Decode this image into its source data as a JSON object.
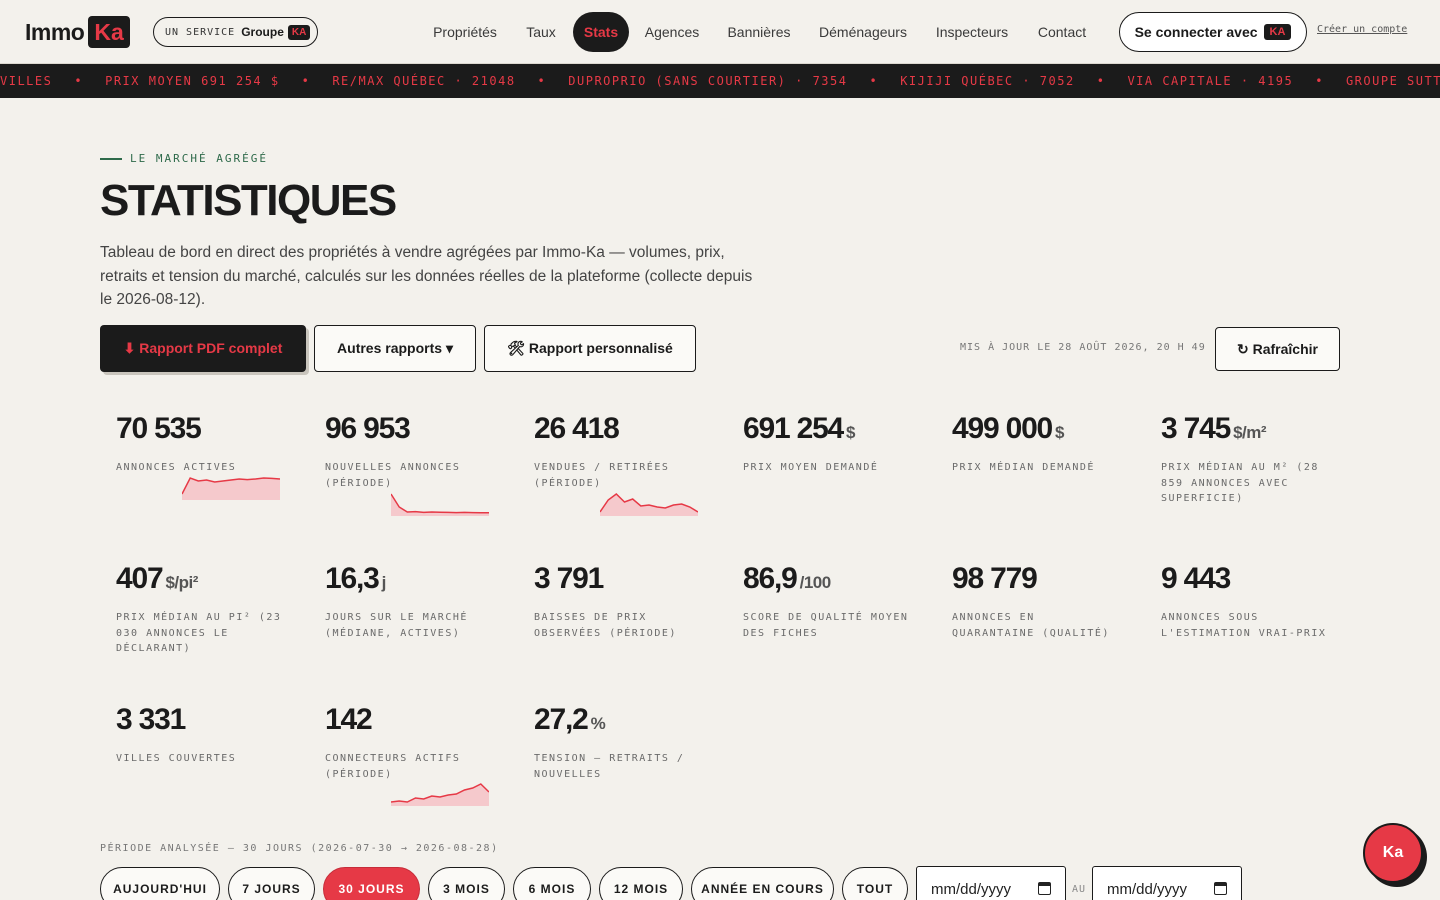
{
  "header": {
    "logo": {
      "immo": "Immo",
      "ka": "Ka"
    },
    "service": {
      "un": "UN SERVICE",
      "groupe": "Groupe",
      "badge": "KA"
    },
    "nav": [
      "Propriétés",
      "Taux",
      "Stats",
      "Agences",
      "Bannières",
      "Déménageurs",
      "Inspecteurs",
      "Contact"
    ],
    "active_nav": "Stats",
    "connect_label": "Se connecter avec",
    "connect_badge": "KA",
    "create_account": "Créer un compte"
  },
  "ticker": [
    "VILLES",
    "PRIX MOYEN 691 254 $",
    "RE/MAX QUÉBEC · 21048",
    "DUPROPRIO (SANS COURTIER) · 7354",
    "KIJIJI QUÉBEC · 7052",
    "VIA CAPITALE · 4195",
    "GROUPE SUTTON QUÉBEC ·"
  ],
  "hero": {
    "eyebrow": "LE MARCHÉ AGRÉGÉ",
    "title": "STATISTIQUES",
    "description": "Tableau de bord en direct des propriétés à vendre agrégées par Immo-Ka — volumes, prix, retraits et tension du marché, calculés sur les données réelles de la plateforme (collecte depuis le 2026-08-12)."
  },
  "actions": {
    "pdf": "⬇ Rapport PDF complet",
    "other": "Autres rapports ▾",
    "custom": "🛠 Rapport personnalisé",
    "updated": "MIS À JOUR LE 28 AOÛT 2026, 20 H 49",
    "refresh": "↻ Rafraîchir"
  },
  "stats": [
    {
      "value": "70 535",
      "unit": "",
      "label": "ANNONCES ACTIVES"
    },
    {
      "value": "96 953",
      "unit": "",
      "label": "NOUVELLES ANNONCES (PÉRIODE)"
    },
    {
      "value": "26 418",
      "unit": "",
      "label": "VENDUES / RETIRÉES (PÉRIODE)"
    },
    {
      "value": "691 254",
      "unit": "$",
      "label": "PRIX MOYEN DEMANDÉ"
    },
    {
      "value": "499 000",
      "unit": "$",
      "label": "PRIX MÉDIAN DEMANDÉ"
    },
    {
      "value": "3 745",
      "unit": "$/m²",
      "label": "PRIX MÉDIAN AU M² (28 859 ANNONCES AVEC SUPERFICIE)"
    },
    {
      "value": "407",
      "unit": "$/pi²",
      "label": "PRIX MÉDIAN AU PI² (23 030 ANNONCES LE DÉCLARANT)"
    },
    {
      "value": "16,3",
      "unit": "j",
      "label": "JOURS SUR LE MARCHÉ (MÉDIANE, ACTIVES)"
    },
    {
      "value": "3 791",
      "unit": "",
      "label": "BAISSES DE PRIX OBSERVÉES (PÉRIODE)"
    },
    {
      "value": "86,9",
      "unit": "/100",
      "label": "SCORE DE QUALITÉ MOYEN DES FICHES"
    },
    {
      "value": "98 779",
      "unit": "",
      "label": "ANNONCES EN QUARANTAINE (QUALITÉ)"
    },
    {
      "value": "9 443",
      "unit": "",
      "label": "ANNONCES SOUS L'ESTIMATION VRAI-PRIX"
    },
    {
      "value": "3 331",
      "unit": "",
      "label": "VILLES COUVERTES"
    },
    {
      "value": "142",
      "unit": "",
      "label": "CONNECTEURS ACTIFS (PÉRIODE)"
    },
    {
      "value": "27,2",
      "unit": "%",
      "label": "TENSION — RETRAITS / NOUVELLES"
    }
  ],
  "sparklines": {
    "accent": "#e63946",
    "fill": "#f5c9cc",
    "annonces_actives": [
      0.2,
      1.0,
      0.85,
      0.9,
      0.8,
      0.85,
      0.9,
      0.95,
      0.92,
      0.95,
      1.0,
      0.98,
      0.95
    ],
    "nouvelles": [
      1.0,
      0.35,
      0.1,
      0.12,
      0.08,
      0.1,
      0.09,
      0.08,
      0.07,
      0.08,
      0.07,
      0.06,
      0.06
    ],
    "vendues": [
      0.1,
      0.7,
      1.0,
      0.6,
      0.75,
      0.4,
      0.45,
      0.35,
      0.3,
      0.45,
      0.5,
      0.35,
      0.1
    ],
    "connecteurs": [
      0.1,
      0.15,
      0.1,
      0.3,
      0.25,
      0.4,
      0.35,
      0.45,
      0.5,
      0.7,
      0.8,
      1.0,
      0.6
    ]
  },
  "period": {
    "label": "PÉRIODE ANALYSÉE — 30 JOURS (2026-07-30 → 2026-08-28)",
    "options": [
      "Aujourd'hui",
      "7 jours",
      "30 jours",
      "3 mois",
      "6 mois",
      "12 mois",
      "Année en cours",
      "Tout"
    ],
    "active": "30 jours",
    "date_placeholder": "mm/dd/yyyy",
    "au": "AU"
  },
  "fab_label": "Ka"
}
